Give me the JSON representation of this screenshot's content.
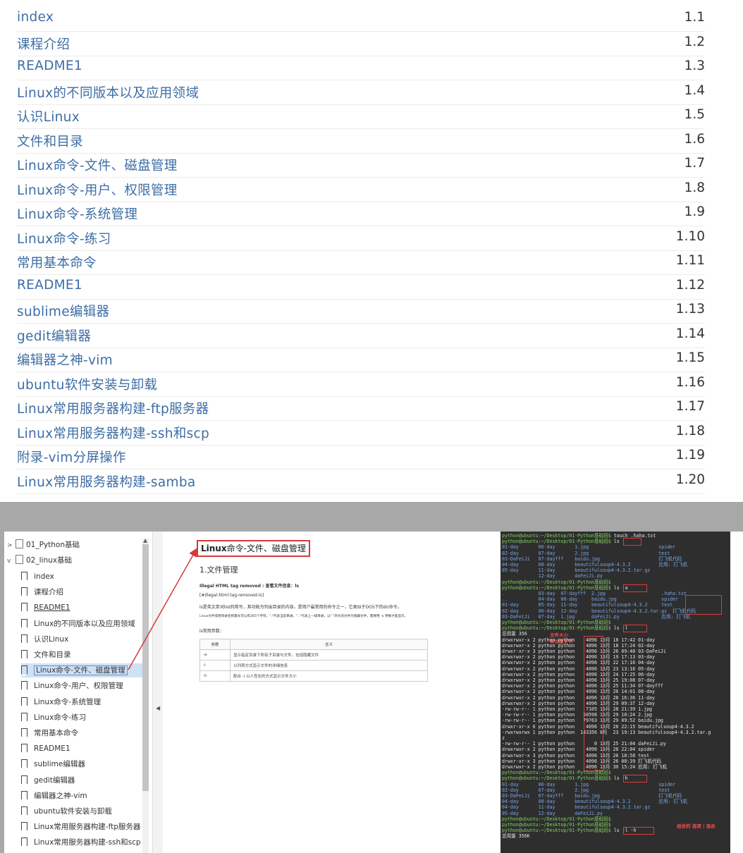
{
  "toc": [
    {
      "title": "index",
      "num": "1.1"
    },
    {
      "title": "课程介绍",
      "num": "1.2"
    },
    {
      "title": "README1",
      "num": "1.3"
    },
    {
      "title": "Linux的不同版本以及应用领域",
      "num": "1.4"
    },
    {
      "title": "认识Linux",
      "num": "1.5"
    },
    {
      "title": "文件和目录",
      "num": "1.6"
    },
    {
      "title": "Linux命令-文件、磁盘管理",
      "num": "1.7"
    },
    {
      "title": "Linux命令-用户、权限管理",
      "num": "1.8"
    },
    {
      "title": "Linux命令-系统管理",
      "num": "1.9"
    },
    {
      "title": "Linux命令-练习",
      "num": "1.10"
    },
    {
      "title": "常用基本命令",
      "num": "1.11"
    },
    {
      "title": "README1",
      "num": "1.12"
    },
    {
      "title": "sublime编辑器",
      "num": "1.13"
    },
    {
      "title": "gedit编辑器",
      "num": "1.14"
    },
    {
      "title": "编辑器之神-vim",
      "num": "1.15"
    },
    {
      "title": "ubuntu软件安装与卸载",
      "num": "1.16"
    },
    {
      "title": "Linux常用服务器构建-ftp服务器",
      "num": "1.17"
    },
    {
      "title": "Linux常用服务器构建-ssh和scp",
      "num": "1.18"
    },
    {
      "title": "附录-vim分屏操作",
      "num": "1.19"
    },
    {
      "title": "Linux常用服务器构建-samba",
      "num": "1.20"
    }
  ],
  "sidebar": {
    "folders": [
      "01_Python基础",
      "02_linux基础"
    ],
    "items": [
      "index",
      "课程介绍",
      "README1",
      "Linux的不同版本以及应用领域",
      "认识Linux",
      "文件和目录",
      "Linux命令-文件、磁盘管理",
      "Linux命令-用户、权限管理",
      "Linux命令-系统管理",
      "Linux命令-练习",
      "常用基本命令",
      "README1",
      "sublime编辑器",
      "gedit编辑器",
      "编辑器之神-vim",
      "ubuntu软件安装与卸载",
      "Linux常用服务器构建-ftp服务器",
      "Linux常用服务器构建-ssh和scp"
    ],
    "selected_index": 6
  },
  "doc": {
    "title_bold": "Linux",
    "title_rest": "命令-文件、磁盘管理",
    "section": "1.文件管理",
    "line1": "Illegal HTML tag removed : 查看文件信息：ls",
    "line2": "[#illegal-html-tag-removed-ls]",
    "line3": "ls是英文单词list的简写，其功能为列出目录的内容，是用户最常用的命令之一，它类似于DOS下的dir命令。",
    "line4": "Linux文件或者目录名称最长可以有265个字符，\".\"代表当前目录，\"..\"代表上一级目录，以\".\"开头的文件为隐藏文件，需要用 -a 参数才能显示。",
    "line5": "ls常用参数：",
    "table_head": [
      "参数",
      "含义"
    ],
    "table_rows": [
      [
        "-a",
        "显示指定目录下所有子目录与文件，包括隐藏文件"
      ],
      [
        "-l",
        "以列表方式显示文件的详细信息"
      ],
      [
        "-h",
        "配合 -l 以人性化的方式显示文件大小"
      ]
    ]
  },
  "terminal": {
    "prompt": "python@ubuntu:~/Desktop/01-Python基础班$",
    "cmd1": "touch .haha.txt",
    "cmd2": "ls",
    "cmd3": "ls -a",
    "cmd4": "ls -l",
    "cmd5": "ls -h",
    "cmd6": "ls -l -h",
    "total": "总用量 356",
    "notes": [
      "文件大小",
      "单位是字节",
      "hidden .haha.txt",
      "组合的 选项 | 混合"
    ],
    "ls_out": [
      "01-day       06-day       1.jpg                         spider",
      "02-day       07-day       2.jpg                         test",
      "03-DaFeiJi   07-dayfff    baidu.jpg                     打飞机代码",
      "04-day       08-day       beautifulsoup4-4.3.2          应用: 打飞机",
      "05-day       11-day       beautifulsoup4-4.3.2.tar.gz",
      "             12-day       daFeiJi.py"
    ],
    "lsa_out": [
      ".            03-day  07-dayfff  2.jpg                    .haha.txt",
      "..           04-day  08-day     baidu.jpg                spider",
      "01-day       05-day  11-day     beautifulsoup4-4.3.2     test",
      "02-day       06-day  12-day     beautifulsoup4-4.3.2.tar.gz  打飞机代码",
      "03-DaFeiJi   07-day  1.jpg      daFeiJi.py               应用: 打飞机"
    ],
    "lsl_out": [
      "drwxrwxr-x 2 python python    4096 10月 18 17:42 01-day",
      "drwxrwxr-x 2 python python    4096 10月 18 17:24 02-day",
      "drwxr-xr-x 3 python python    4096 10月 26 09:40 03-DaFeiJi",
      "drwxrwxr-x 2 python python    4096 10月 19 17:13 03-day",
      "drwxrwxr-x 2 python python    4096 10月 22 17:16 04-day",
      "drwxrwxr-x 2 python python    4096 10月 23 13:16 05-day",
      "drwxrwxr-x 2 python python    4096 10月 24 17:25 06-day",
      "drwxrwxr-x 2 python python    4096 10月 25 19:08 07-day",
      "drwxrwxr-x 2 python python    4096 10月 25 11:34 07-dayfff",
      "drwxrwxr-x 2 python python    4096 10月 26 14:01 08-day",
      "drwxrwxr-x 2 python python    4096 10月 28 16:36 11-day",
      "drwxrwxr-x 2 python python    4096 10月 29 09:37 12-day",
      "-rw-rw-r-- 1 python python    7105 10月 28 21:39 1.jpg",
      "-rw-rw-r-- 1 python python   50598 10月 29 10:24 2.jpg",
      "-rw-rw-r-- 1 python python   79763 10月 29 09:52 baidu.jpg",
      "drwxr-xr-x 6 python python    4096 10月 28 22:15 beautifulsoup4-4.3.2",
      "-rwxrwxrwx 1 python python  143356 8月  23 19:13 beautifulsoup4-4.3.2.tar.g",
      "z",
      "-rw-rw-r-- 1 python python       0 10月 25 21:04 daFeiJi.py",
      "drwxrwxr-x 2 python python    4096 10月 28 22:04 spider",
      "drwxrwxr-x 3 python python    4096 10月 26 18:58 test",
      "drwxr-xr-x 3 python python    4096 10月 26 08:39 打飞机代码",
      "drwxrwxr-x 2 python python    4096 10月 30 15:24 应用: 打飞机"
    ],
    "lsh_out": [
      "01-day       06-day       1.jpg                         spider",
      "02-day       07-day       2.jpg                         test",
      "03-DaFeiJi   07-dayfff    baidu.jpg                     打飞机代码",
      "04-day       08-day       beautifulsoup4-4.3.2          应用: 打飞机",
      "04-day       11-day       beautifulsoup4-4.3.2.tar.gz",
      "05-day       12-day       daFeiJi.py"
    ],
    "last": "总用量 356K"
  }
}
